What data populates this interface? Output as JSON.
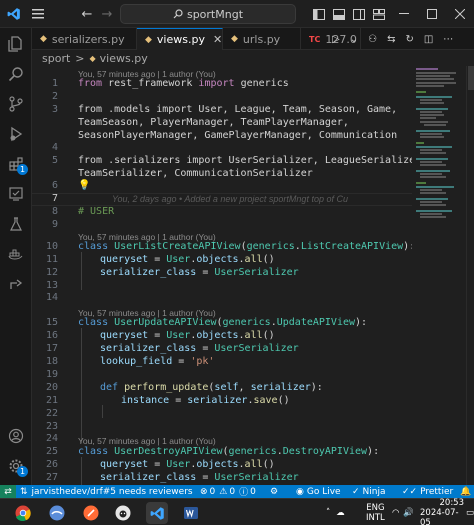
{
  "titlebar": {
    "search_text": "sportMngt",
    "back": "←",
    "forward": "→"
  },
  "activity_bar": {
    "items": [
      {
        "name": "explorer-icon"
      },
      {
        "name": "search-icon"
      },
      {
        "name": "source-control-icon"
      },
      {
        "name": "run-debug-icon"
      },
      {
        "name": "extensions-icon",
        "badge": "1"
      },
      {
        "name": "remote-explorer-icon"
      },
      {
        "name": "testing-icon"
      },
      {
        "name": "docker-icon"
      },
      {
        "name": "live-share-icon"
      }
    ],
    "bottom": [
      {
        "name": "account-icon"
      },
      {
        "name": "manage-gear-icon",
        "badge": "1"
      }
    ]
  },
  "tabs": [
    {
      "label": "serializers.py",
      "active": false
    },
    {
      "label": "views.py",
      "active": true
    },
    {
      "label": "urls.py",
      "active": false
    },
    {
      "label": "127.0",
      "active": false
    }
  ],
  "breadcrumb": {
    "folder": "sport",
    "sep": ">",
    "file": "views.py"
  },
  "editor": {
    "lens": "You, 57 minutes ago | 1 author (You)",
    "blame": "You, 2 days ago • Added a new project sportMngt top of Cu",
    "lines": {
      "l1": "from rest_framework import generics",
      "l3a": "from .models import User, League, Team, Season, Game,",
      "l3b": "TeamSeason, PlayerManager, TeamPlayerManager,",
      "l3c": "SeasonPlayerManager, GamePlayerManager, Communication",
      "l5a": "from .serializers import UserSerializer, LeagueSerializer,",
      "l5b": "TeamSerializer, CommunicationSerializer",
      "l8": "# USER",
      "l10": "class UserListCreateAPIView(generics.ListCreateAPIView):",
      "l11": "queryset = User.objects.all()",
      "l12": "serializer_class = UserSerializer",
      "l15": "class UserUpdateAPIView(generics.UpdateAPIView):",
      "l16": "queryset = User.objects.all()",
      "l17": "serializer_class = UserSerializer",
      "l18": "lookup_field = 'pk'",
      "l20": "def perform_update(self, serializer):",
      "l21": "instance = serializer.save()",
      "l25": "class UserDestroyAPIView(generics.DestroyAPIView):",
      "l26": "queryset = User.objects.all()",
      "l27": "serializer_class = UserSerializer"
    },
    "line_numbers": [
      "1",
      "2",
      "3",
      "4",
      "5",
      "6",
      "7",
      "8",
      "9",
      "10",
      "11",
      "12",
      "13",
      "14",
      "15",
      "16",
      "17",
      "18",
      "19",
      "20",
      "21",
      "22",
      "23",
      "24",
      "25",
      "26",
      "27"
    ]
  },
  "statusbar": {
    "branch": "jarvisthedev/drf#5 needs reviewers",
    "errors": "0",
    "warnings": "0",
    "info": "0",
    "go_live": "Go Live",
    "ninja": "Ninja",
    "prettier": "Prettier"
  },
  "taskbar": {
    "lang": "ENG",
    "region": "INTL",
    "time": "20:53",
    "date": "2024-07-05"
  },
  "colors": {
    "accent": "#0078d4",
    "statusbar": "#007acc"
  }
}
